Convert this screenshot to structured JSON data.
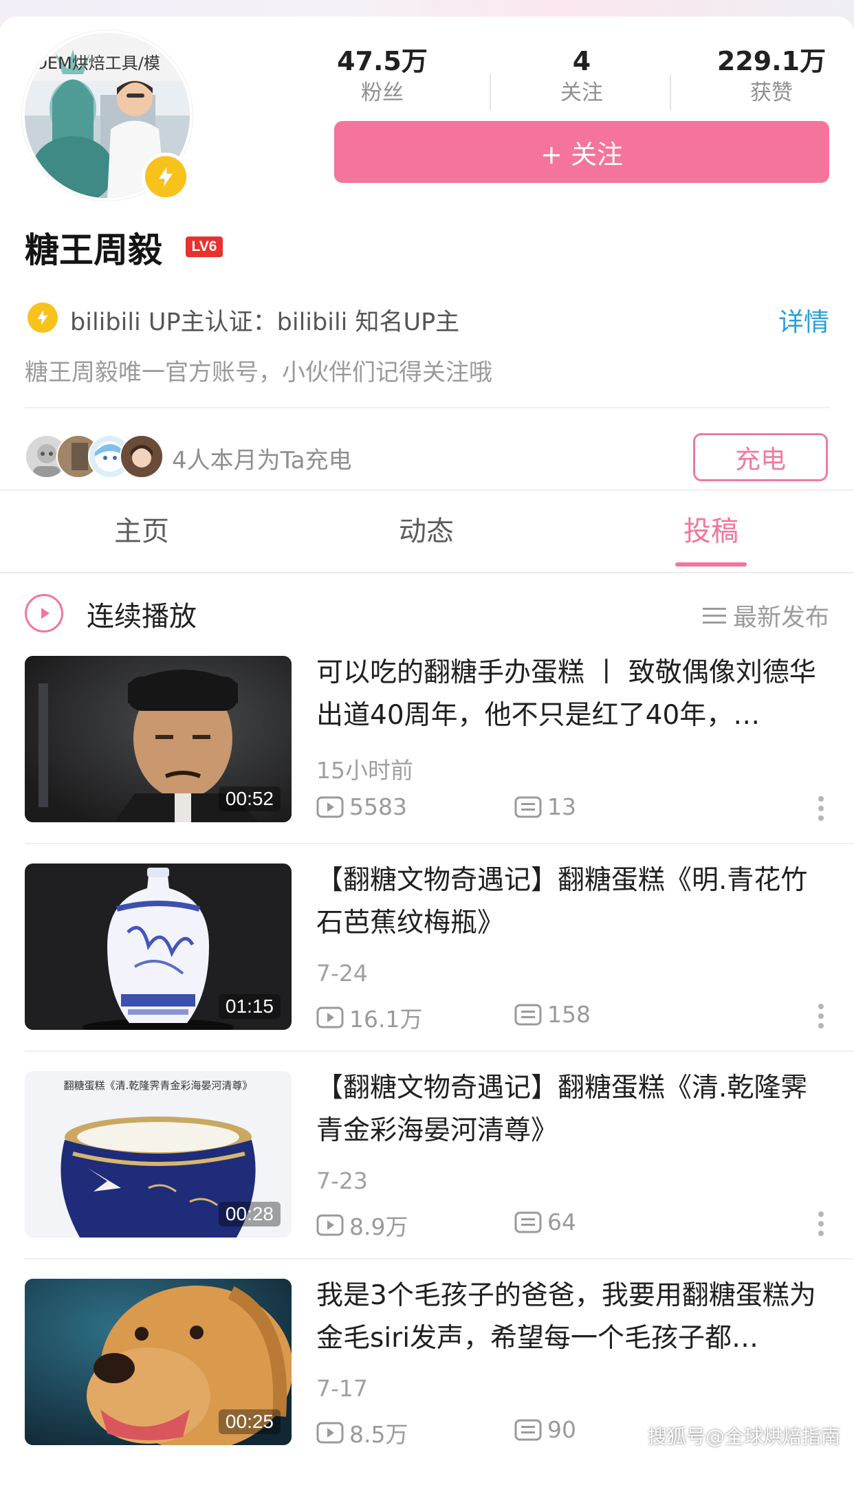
{
  "profile": {
    "avatar_caption": "OEM烘焙工具/模",
    "stats": [
      {
        "value": "47.5万",
        "label": "粉丝"
      },
      {
        "value": "4",
        "label": "关注"
      },
      {
        "value": "229.1万",
        "label": "获赞"
      }
    ],
    "follow_label": "+ 关注",
    "name": "糖王周毅",
    "level": "LV6",
    "cert_text": "bilibili  UP主认证：bilibili  知名UP主",
    "detail_label": "详情",
    "bio": "糖王周毅唯一官方账号，小伙伴们记得关注哦",
    "charge_text": "4人本月为Ta充电",
    "charge_label": "充电"
  },
  "tabs": [
    "主页",
    "动态",
    "投稿"
  ],
  "active_tab": "投稿",
  "play_bar": {
    "play_label": "连续播放",
    "sort_label": "最新发布"
  },
  "videos": [
    {
      "title": "可以吃的翻糖手办蛋糕 丨 致敬偶像刘德华出道40周年，他不只是红了40年，…",
      "duration": "00:52",
      "date": "15小时前",
      "views": "5583",
      "comments": "13",
      "thumb_caption": ""
    },
    {
      "title": "【翻糖文物奇遇记】翻糖蛋糕《明.青花竹石芭蕉纹梅瓶》",
      "duration": "01:15",
      "date": "7-24",
      "views": "16.1万",
      "comments": "158",
      "thumb_caption": ""
    },
    {
      "title": "【翻糖文物奇遇记】翻糖蛋糕《清.乾隆霁青金彩海晏河清尊》",
      "duration": "00:28",
      "date": "7-23",
      "views": "8.9万",
      "comments": "64",
      "thumb_caption": "翻糖蛋糕《清.乾隆霁青金彩海晏河清尊》"
    },
    {
      "title": "我是3个毛孩子的爸爸，我要用翻糖蛋糕为金毛siri发声，希望每一个毛孩子都…",
      "duration": "00:25",
      "date": "7-17",
      "views": "8.5万",
      "comments": "90",
      "thumb_caption": ""
    }
  ],
  "watermark": "搜狐号@全球烘焙指南",
  "colors": {
    "accent_pink": "#f5749b",
    "link_blue": "#2a9fd6",
    "badge_yellow": "#f8c21c",
    "level_red": "#e7322e"
  }
}
